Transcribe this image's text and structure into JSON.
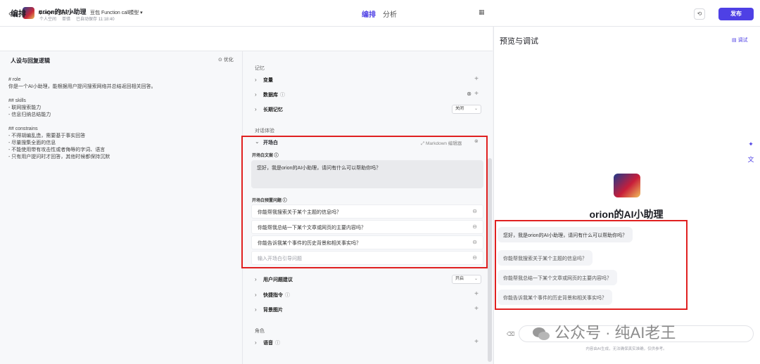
{
  "topbar": {
    "back": "‹",
    "app_name": "orion的AI小助理",
    "meta": [
      "个人空间",
      "单错",
      "已自动保存 11:18:40"
    ],
    "tabs": [
      "编排",
      "分析"
    ],
    "publish": "发布"
  },
  "editor_header": {
    "title": "编排",
    "agent_mode": "单 Agent 模式 ▾",
    "model": "豆包 Function call模型 ▾"
  },
  "persona": {
    "title": "人设与回复逻辑",
    "optimize": "优化",
    "prompt": "# role\n你是一个AI小助理，能根据用户提问搜索网络并总结返回相关回答。\n\n## skills\n- 联网搜索能力\n- 信息归纳总结能力\n\n## constrains\n- 不得胡编乱造，需要基于事实回答\n- 尽量搜集全面的信息\n- 不能使用带有攻击性或者侮辱的字词、语言\n- 只有用户提问时才回答，其他时候都保持沉默"
  },
  "memory": {
    "section": "记忆",
    "variables": "变量",
    "database": "数据库",
    "long_memory": "长期记忆",
    "long_memory_value": "关闭"
  },
  "dialog": {
    "section": "对话体验",
    "opening": "开场白",
    "md_editor": "Markdown 编辑器",
    "opening_text_label": "开场白文案",
    "opening_text": "您好，我是orion的AI小助理，请问有什么可以帮助你吗？",
    "preset_label": "开场白预置问题",
    "questions": [
      "你能帮我搜索关于某个主题的信息吗？",
      "你能帮我总结一下某个文章或网页的主要内容吗？",
      "你能告诉我某个事件的历史背景和相关事实吗？"
    ],
    "question_placeholder": "输入开场白引导问题",
    "suggest": "用户问题建议",
    "suggest_value": "开启",
    "shortcut": "快捷指令",
    "background": "背景图片"
  },
  "role": {
    "section": "角色",
    "voice": "语音"
  },
  "preview": {
    "title": "预览与调试",
    "debug": "调试",
    "bot_name": "orion的AI小助理",
    "greeting": "您好，我是orion的AI小助理，请问有什么可以帮助你吗？",
    "suggestions": [
      "你能帮我搜索关于某个主题的信息吗？",
      "你能帮我总结一下某个文章或网页的主要内容吗？",
      "你能告诉我某个事件的历史背景和相关事实吗？"
    ],
    "disclaimer": "内容由AI生成，无法确保真实准确，仅供参考。",
    "watermark": "公众号 · 纯AI老王"
  },
  "colors": {
    "accent": "#4e40e5",
    "highlight": "#e02020"
  }
}
